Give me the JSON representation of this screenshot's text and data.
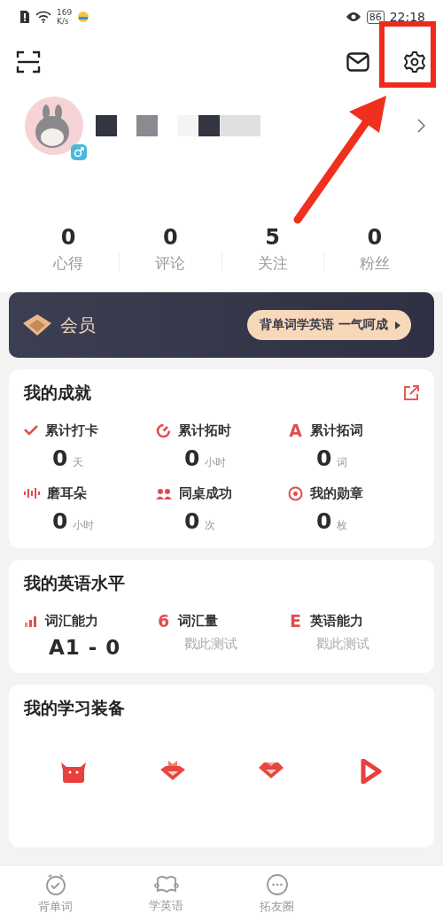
{
  "status_bar": {
    "speed": "169",
    "speed_unit": "K/s",
    "battery": "86",
    "time": "22:18"
  },
  "stats": [
    {
      "value": "0",
      "label": "心得"
    },
    {
      "value": "0",
      "label": "评论"
    },
    {
      "value": "5",
      "label": "关注"
    },
    {
      "value": "0",
      "label": "粉丝"
    }
  ],
  "member": {
    "title": "会员",
    "slogan": "背单词学英语 一气呵成"
  },
  "achievements": {
    "title": "我的成就",
    "items": [
      {
        "kind": "check",
        "label": "累计打卡",
        "value": "0",
        "unit": "天"
      },
      {
        "kind": "timer",
        "label": "累计拓时",
        "value": "0",
        "unit": "小时"
      },
      {
        "kind": "glyph",
        "glyph": "A",
        "label": "累计拓词",
        "value": "0",
        "unit": "词"
      },
      {
        "kind": "wave",
        "label": "磨耳朵",
        "value": "0",
        "unit": "小时"
      },
      {
        "kind": "people",
        "label": "同桌成功",
        "value": "0",
        "unit": "次"
      },
      {
        "kind": "medal",
        "label": "我的勋章",
        "value": "0",
        "unit": "枚"
      }
    ]
  },
  "english": {
    "title": "我的英语水平",
    "items": [
      {
        "kind": "bars",
        "label": "词汇能力",
        "value": "A1 - 0",
        "tested": true
      },
      {
        "kind": "glyph",
        "glyph": "6",
        "label": "词汇量",
        "value": "戳此测试",
        "tested": false
      },
      {
        "kind": "glyph",
        "glyph": "E",
        "label": "英语能力",
        "value": "戳此测试",
        "tested": false
      }
    ]
  },
  "equipment": {
    "title": "我的学习装备",
    "items": [
      {
        "kind": "monster"
      },
      {
        "kind": "crown"
      },
      {
        "kind": "gem"
      },
      {
        "kind": "play"
      }
    ]
  },
  "tabs": [
    {
      "kind": "clock",
      "label": "背单词",
      "selected": false
    },
    {
      "kind": "book",
      "label": "学英语",
      "selected": false
    },
    {
      "kind": "chat",
      "label": "拓友圈",
      "selected": false
    }
  ]
}
